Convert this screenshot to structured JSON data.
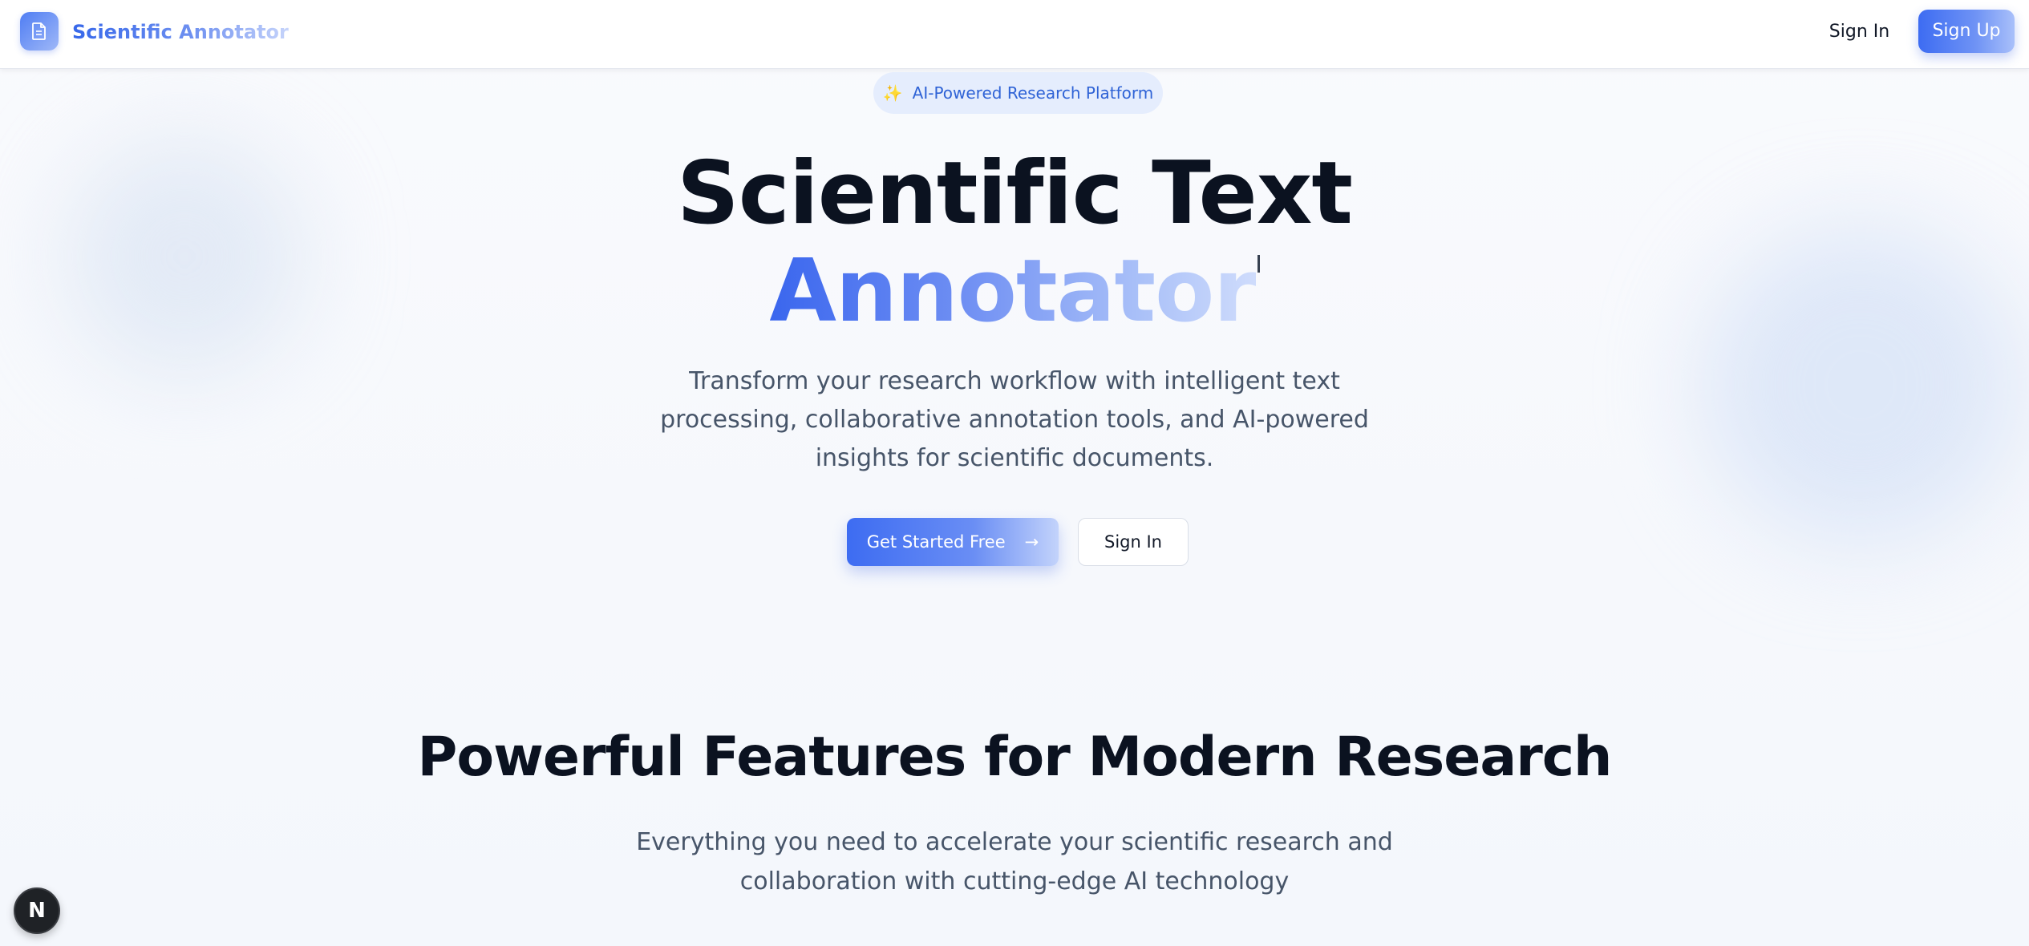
{
  "header": {
    "brand": "Scientific Annotator",
    "logo_icon": "document-icon",
    "sign_in_label": "Sign In",
    "sign_up_label": "Sign Up"
  },
  "hero": {
    "badge_icon": "sparkles-icon",
    "badge_label": "AI-Powered Research Platform",
    "title_line1": "Scientific Text",
    "title_line2": "Annotator",
    "subtitle": "Transform your research workflow with intelligent text processing, collaborative annotation tools, and AI-powered insights for scientific documents.",
    "primary_cta": "Get Started Free",
    "primary_cta_icon": "arrow-right-icon",
    "secondary_cta": "Sign In"
  },
  "features": {
    "title": "Powerful Features for Modern Research",
    "subtitle": "Everything you need to accelerate your scientific research and collaboration with cutting-edge AI technology"
  },
  "dev_badge": {
    "label": "N",
    "icon": "nextjs-icon"
  },
  "colors": {
    "accent": "#3d6cf2",
    "accent_light": "#a9c0fa",
    "badge_bg": "#e5edfd",
    "text_dark": "#0b1220",
    "text_muted": "#475569"
  }
}
